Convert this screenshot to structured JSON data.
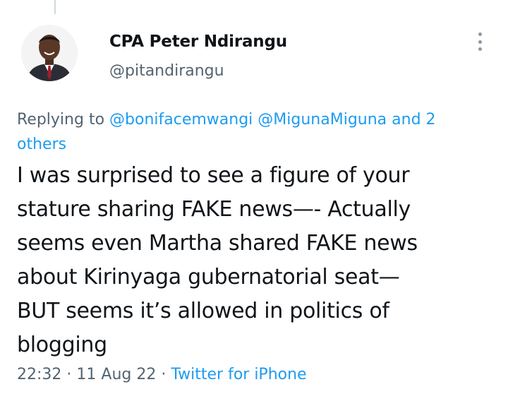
{
  "author": {
    "display_name": "CPA Peter Ndirangu",
    "handle": "@pitandirangu"
  },
  "reply": {
    "prefix": "Replying to",
    "mentions": [
      "@bonifacemwangi",
      "@MigunaMiguna"
    ],
    "and_text": "and 2",
    "others_text": "others"
  },
  "tweet": {
    "lines": [
      "I was surprised to see a figure of your",
      "stature sharing FAKE news—- Actually",
      "seems even Martha shared FAKE news",
      "about Kirinyaga gubernatorial seat—",
      "BUT seems it’s allowed in politics of",
      "blogging"
    ]
  },
  "meta": {
    "time": "22:32",
    "separator": "·",
    "date": "11 Aug 22",
    "source": "Twitter for iPhone"
  },
  "icons": {
    "more": "more-options-icon"
  },
  "colors": {
    "link": "#1d9bf0",
    "secondary_text": "#536471",
    "primary_text": "#0f1419",
    "thread_line": "#cfd9de"
  }
}
